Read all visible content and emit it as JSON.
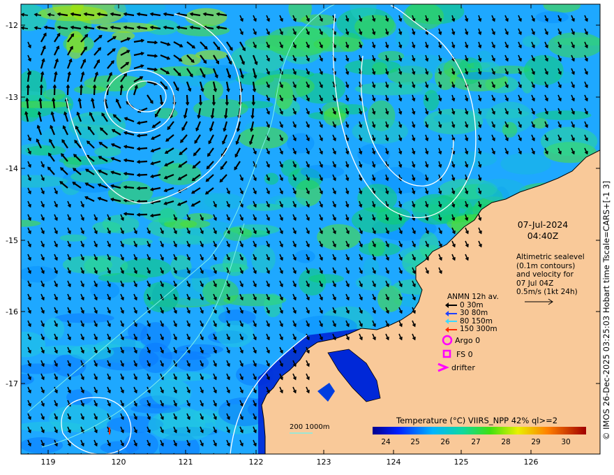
{
  "map": {
    "y_ticks": [
      "-12",
      "-13",
      "-14",
      "-15",
      "-16",
      "-17"
    ],
    "x_ticks": [
      "119",
      "120",
      "121",
      "122",
      "123",
      "124",
      "125",
      "126"
    ]
  },
  "annotation": {
    "date": "07-Jul-2024",
    "time": "04:40Z",
    "alti_lines": [
      "Altimetric sealevel",
      "(0.1m contours)",
      "and velocity for",
      "07 Jul 04Z",
      "0.5m/s (1kt 24h)"
    ]
  },
  "anmn_legend": {
    "title": "ANMN 12h av.",
    "items": [
      {
        "label": "0 30m",
        "color": "#000000"
      },
      {
        "label": "30 80m",
        "color": "#1e40ff"
      },
      {
        "label": "80 150m",
        "color": "#3dd9ff"
      },
      {
        "label": "150 300m",
        "color": "#ff2a00"
      }
    ],
    "argo": "Argo 0",
    "fs": "FS 0",
    "drifter": "drifter"
  },
  "colorbar": {
    "title": "Temperature (°C) VIIRS_NPP 42% ql>=2",
    "ticks": [
      "24",
      "25",
      "26",
      "27",
      "28",
      "29",
      "30"
    ]
  },
  "bathymetry_label": "200  1000m",
  "credit": "© IMOS 26-Dec-2025 03:25:03 Hobart time Tscale=CARS+[-1 3]",
  "colors": {
    "land": "#f9c999",
    "contour": "#ffffff",
    "bathy": "#7ff0e8",
    "marker": "#ff00ff"
  }
}
